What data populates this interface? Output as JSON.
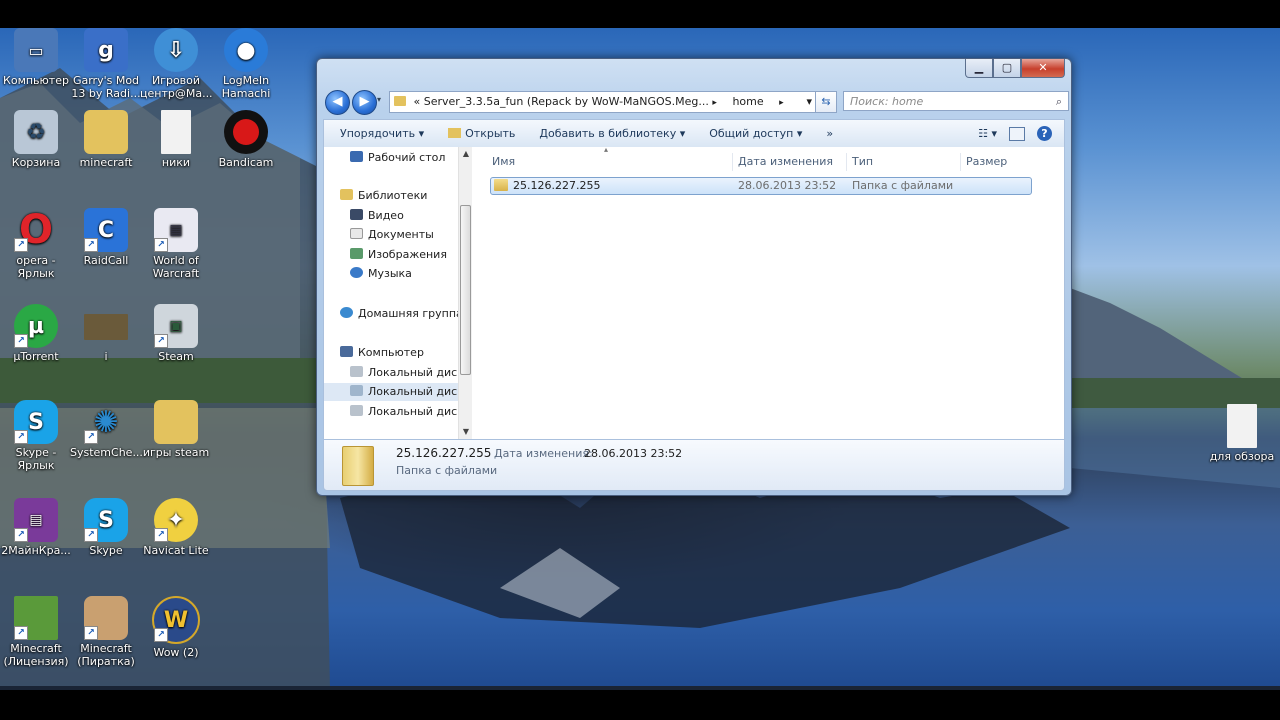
{
  "desktop": {
    "icons": [
      {
        "label": "Компьютер",
        "icon": "computer-icon",
        "color": "#4a78b8"
      },
      {
        "label": "Garry's Mod 13 by Radi...",
        "icon": "garrys-mod-icon",
        "color": "#3a6fc8"
      },
      {
        "label": "Игровой центр@Ma...",
        "icon": "game-center-icon",
        "color": "#3f8fd6"
      },
      {
        "label": "LogMeIn Hamachi",
        "icon": "hamachi-icon",
        "color": "#2a7bd8"
      },
      {
        "label": "Корзина",
        "icon": "recycle-bin-icon",
        "color": "#b9c7d6"
      },
      {
        "label": "minecraft",
        "icon": "folder-icon",
        "color": "#e3c25e"
      },
      {
        "label": "ники",
        "icon": "text-file-icon",
        "color": "#f2f2f2"
      },
      {
        "label": "Bandicam",
        "icon": "bandicam-icon",
        "color": "#d81818"
      },
      {
        "label": "opera - Ярлык",
        "icon": "opera-icon",
        "color": "#e0242a"
      },
      {
        "label": "RaidCall",
        "icon": "raidcall-icon",
        "color": "#2a73d8"
      },
      {
        "label": "World of Warcraft",
        "icon": "wow-shortcut-icon",
        "color": "#e9e9f2"
      },
      {
        "label": "µTorrent",
        "icon": "utorrent-icon",
        "color": "#2aa845"
      },
      {
        "label": "i",
        "icon": "game-image-icon",
        "color": "#6a5a3a"
      },
      {
        "label": "Steam",
        "icon": "steam-icon",
        "color": "#cfd6dc"
      },
      {
        "label": "Skype - Ярлык",
        "icon": "skype-icon",
        "color": "#1aa3e8"
      },
      {
        "label": "SystemChe...",
        "icon": "systemcheck-icon",
        "color": "#2a8ad0"
      },
      {
        "label": "игры steam",
        "icon": "folder-icon",
        "color": "#e3c25e"
      },
      {
        "label": "2МайнКрa...",
        "icon": "winrar-icon",
        "color": "#7a3a9a"
      },
      {
        "label": "Skype",
        "icon": "skype-icon",
        "color": "#1aa3e8"
      },
      {
        "label": "Navicat Lite",
        "icon": "navicat-icon",
        "color": "#f0d040"
      },
      {
        "label": "Minecraft (Лицензия)",
        "icon": "minecraft-icon",
        "color": "#5a9a3a"
      },
      {
        "label": "Minecraft (Пиратка)",
        "icon": "minecraft-pirate-icon",
        "color": "#c9a070"
      },
      {
        "label": "Wow (2)",
        "icon": "wow-icon",
        "color": "#2a4a8a"
      },
      {
        "label": "для обзора",
        "icon": "text-file-icon",
        "color": "#f2f2f2"
      }
    ]
  },
  "window": {
    "caption": {
      "minimize": "▁",
      "maximize": "▢",
      "close": "✕"
    },
    "address": {
      "prefix": "«",
      "segment1": "Server_3.3.5a_fun (Repack by WoW-MaNGOS.Meg...",
      "sep": "▸",
      "segment2": "home",
      "dropdown": "▾"
    },
    "search": {
      "placeholder": "Поиск: home"
    },
    "toolbar": {
      "organize": "Упорядочить ▾",
      "open": "Открыть",
      "add_to_library": "Добавить в библиотеку ▾",
      "share": "Общий доступ ▾",
      "more": "»",
      "view": "☷ ▾",
      "help": "?"
    },
    "nav": {
      "desktop": "Рабочий стол",
      "libraries": "Библиотеки",
      "video": "Видео",
      "documents": "Документы",
      "images": "Изображения",
      "music": "Музыка",
      "homegroup": "Домашняя группа",
      "computer": "Компьютер",
      "disk1": "Локальный диск",
      "disk2": "Локальный диск",
      "disk3": "Локальный диск"
    },
    "columns": {
      "name": "Имя",
      "date": "Дата изменения",
      "type": "Тип",
      "size": "Размер"
    },
    "files": [
      {
        "name": "25.126.227.255",
        "date": "28.06.2013 23:52",
        "type": "Папка с файлами",
        "size": ""
      }
    ],
    "details": {
      "name": "25.126.227.255",
      "date_label": "Дата изменения:",
      "date_value": "28.06.2013 23:52",
      "type": "Папка с файлами"
    }
  }
}
